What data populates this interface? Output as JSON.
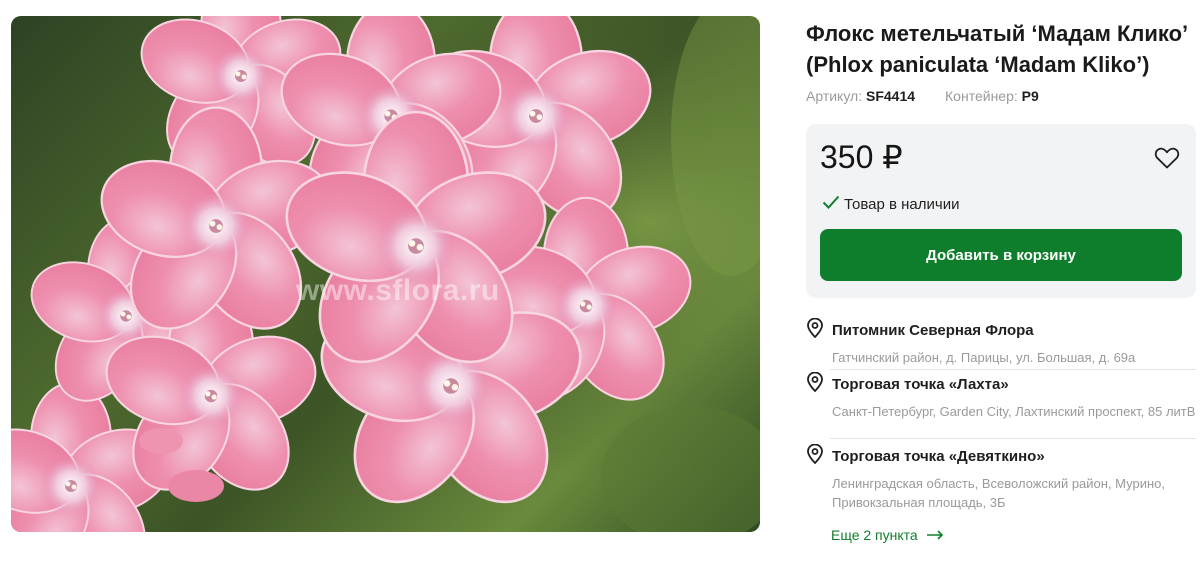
{
  "product": {
    "title": "Флокс метельчатый ‘Мадам Клико’ (Phlox paniculata ‘Madam Kliko’)",
    "sku_label": "Артикул:",
    "sku_value": "SF4414",
    "container_label": "Контейнер:",
    "container_value": "P9",
    "watermark": "www.sflora.ru"
  },
  "purchase": {
    "price": "350 ₽",
    "stock_status": "Товар в наличии",
    "add_to_cart_label": "Добавить в корзину"
  },
  "locations": [
    {
      "name": "Питомник Северная Флора",
      "address": "Гатчинский район, д. Парицы, ул. Большая, д. 69а"
    },
    {
      "name": "Торговая точка «Лахта»",
      "address": "Санкт-Петербург, Garden City, Лахтинский проспект, 85 литВ"
    },
    {
      "name": "Торговая точка «Девяткино»",
      "address": "Ленинградская область, Всеволожский район, Мурино, Привокзальная площадь, 3Б"
    }
  ],
  "more_points_label": "Еще 2 пункта",
  "colors": {
    "accent_green": "#0f7e2c",
    "price_box_bg": "#f2f3f5",
    "muted_text": "#9a9a9a"
  },
  "icons": {
    "favorite": "heart-icon",
    "stock": "check-icon",
    "location": "map-pin-icon",
    "more": "arrow-right-icon"
  }
}
